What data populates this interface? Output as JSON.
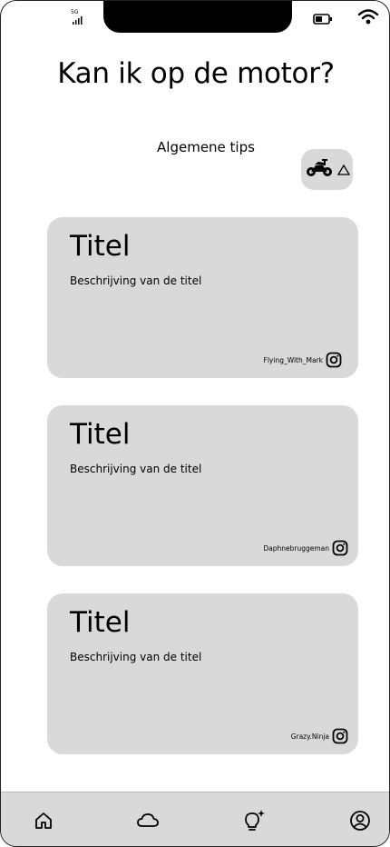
{
  "status_bar": {
    "network_label": "5G"
  },
  "header": {
    "title": "Kan ik op de motor?"
  },
  "section": {
    "label": "Algemene tips"
  },
  "cards": [
    {
      "title": "Titel",
      "description": "Beschrijving van de titel",
      "credit": "Flying_With_Mark"
    },
    {
      "title": "Titel",
      "description": "Beschrijving van de titel",
      "credit": "Daphnebruggeman"
    },
    {
      "title": "Titel",
      "description": "Beschrijving van de titel",
      "credit": "Grazy.Ninja"
    }
  ],
  "nav": {
    "items": [
      {
        "icon": "home-icon"
      },
      {
        "icon": "cloud-icon"
      },
      {
        "icon": "lightbulb-icon"
      },
      {
        "icon": "profile-icon"
      }
    ]
  },
  "colors": {
    "card_bg": "#d9d9d9",
    "nav_bg": "#d9d9d9",
    "text": "#000000"
  }
}
